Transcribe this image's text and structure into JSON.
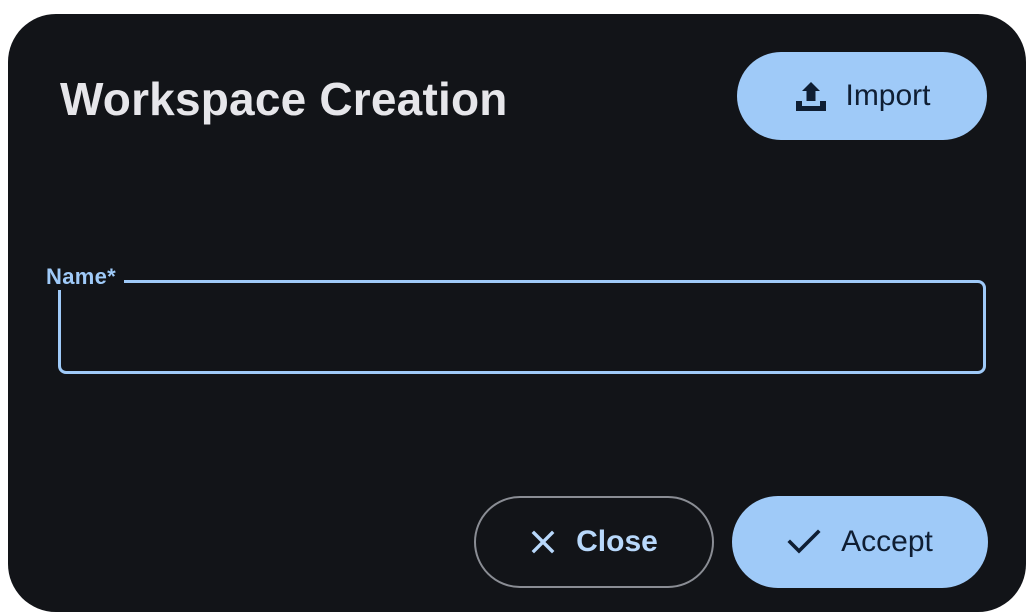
{
  "dialog": {
    "title": "Workspace Creation",
    "import_label": "Import",
    "name_field": {
      "label": "Name*",
      "value": "",
      "placeholder": ""
    },
    "close_label": "Close",
    "accept_label": "Accept"
  },
  "colors": {
    "background": "#121418",
    "accent": "#9fcaf8",
    "title_text": "#e6e6ea",
    "button_text_dark": "#0f1e33"
  },
  "icons": {
    "import": "upload-tray-icon",
    "close": "close-icon",
    "accept": "check-icon"
  }
}
